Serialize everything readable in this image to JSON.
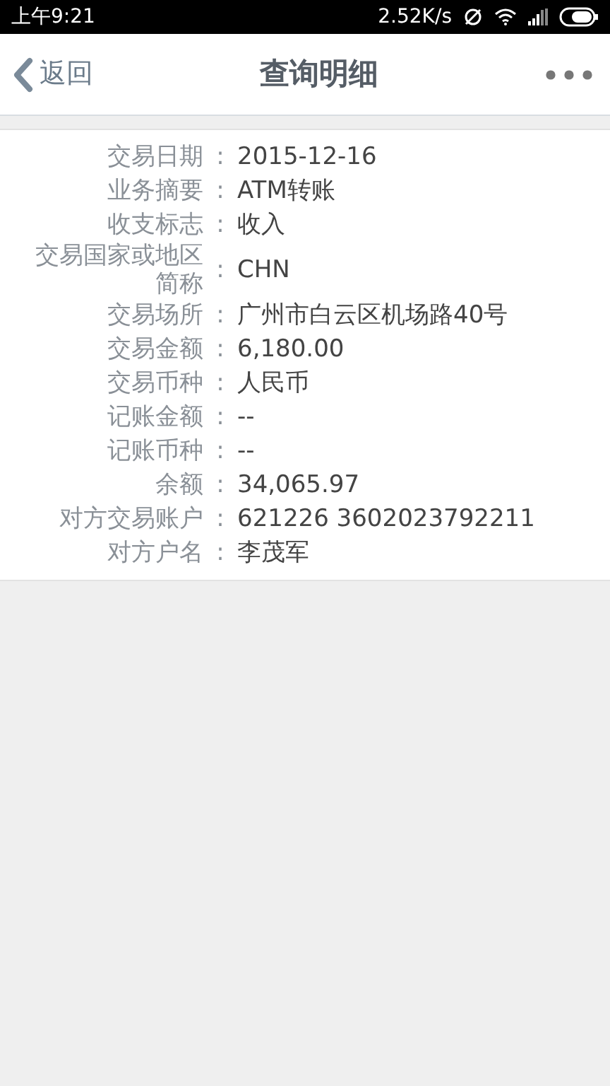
{
  "status_bar": {
    "time": "上午9:21",
    "speed": "2.52K/s"
  },
  "header": {
    "back": "返回",
    "title": "查询明细"
  },
  "rows": [
    {
      "label": "交易日期",
      "separator": ":",
      "value": "2015-12-16"
    },
    {
      "label": "业务摘要",
      "separator": ":",
      "value": "ATM转账"
    },
    {
      "label": "收支标志",
      "separator": ":",
      "value": "收入"
    },
    {
      "label": "交易国家或地区简称",
      "separator": ":",
      "value": "CHN"
    },
    {
      "label": "交易场所",
      "separator": ":",
      "value": "广州市白云区机场路40号"
    },
    {
      "label": "交易金额",
      "separator": ":",
      "value": "6,180.00"
    },
    {
      "label": "交易币种",
      "separator": ":",
      "value": "人民币"
    },
    {
      "label": "记账金额",
      "separator": ":",
      "value": "--"
    },
    {
      "label": "记账币种",
      "separator": ":",
      "value": "--"
    },
    {
      "label": "余额",
      "separator": ":",
      "value": "34,065.97"
    },
    {
      "label": "对方交易账户",
      "separator": ":",
      "value": "621226 3602023792211"
    },
    {
      "label": "对方户名",
      "separator": ":",
      "value": "李茂军"
    }
  ]
}
